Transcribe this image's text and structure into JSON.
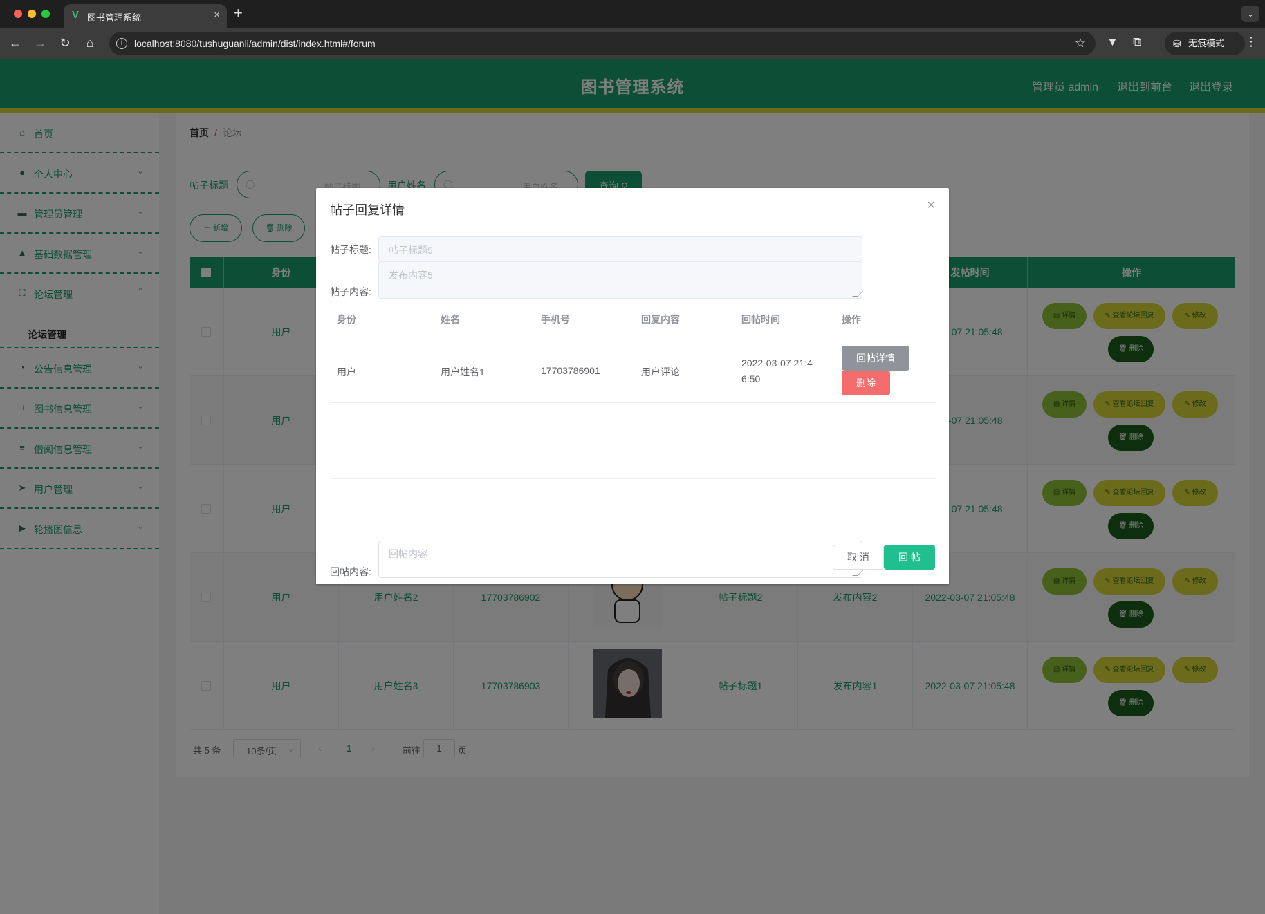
{
  "browser": {
    "tab_title": "图书管理系统",
    "url": "localhost:8080/tushuguanli/admin/dist/index.html#/forum",
    "incognito_label": "无痕模式"
  },
  "header": {
    "title": "图书管理系统",
    "user_label": "管理员 admin",
    "front_link": "退出到前台",
    "logout_link": "退出登录",
    "colors": {
      "primary": "#1a9e6c",
      "stripe": "#d9d739"
    }
  },
  "sidebar": {
    "items": [
      {
        "label": "首页",
        "icon": "home-icon"
      },
      {
        "label": "个人中心",
        "icon": "user-icon"
      },
      {
        "label": "管理员管理",
        "icon": "admin-icon"
      },
      {
        "label": "基础数据管理",
        "icon": "person-data-icon"
      },
      {
        "label": "论坛管理",
        "icon": "fullscreen-icon",
        "sub": "论坛管理"
      },
      {
        "label": "公告信息管理",
        "icon": "dashboard-icon"
      },
      {
        "label": "图书信息管理",
        "icon": "crop-icon"
      },
      {
        "label": "借阅信息管理",
        "icon": "list-icon"
      },
      {
        "label": "用户管理",
        "icon": "send-icon"
      },
      {
        "label": "轮播图信息",
        "icon": "video-icon"
      }
    ]
  },
  "breadcrumb": {
    "home": "首页",
    "current": "论坛"
  },
  "search": {
    "title_label": "帖子标题",
    "title_placeholder": "帖子标题",
    "name_label": "用户姓名",
    "name_placeholder": "用户姓名",
    "query_button": "查询"
  },
  "actions": {
    "add": "新增",
    "delete": "删除"
  },
  "table": {
    "headers": {
      "role": "身份",
      "post_time": "发帖时间",
      "ops": "操作"
    },
    "rows": [
      {
        "role": "用户",
        "name": "",
        "phone": "",
        "title": "",
        "content": "",
        "time": "03-07 21:05:48",
        "has_image": false
      },
      {
        "role": "用户",
        "name": "",
        "phone": "",
        "title": "",
        "content": "",
        "time": "03-07 21:05:48",
        "has_image": false
      },
      {
        "role": "用户",
        "name": "",
        "phone": "",
        "title": "",
        "content": "",
        "time": "03-07 21:05:48",
        "has_image": false
      },
      {
        "role": "用户",
        "name": "用户姓名2",
        "phone": "17703786902",
        "title": "帖子标题2",
        "content": "发布内容2",
        "time": "2022-03-07 21:05:48",
        "has_image": true
      },
      {
        "role": "用户",
        "name": "用户姓名3",
        "phone": "17703786903",
        "title": "帖子标题1",
        "content": "发布内容1",
        "time": "2022-03-07 21:05:48",
        "has_image": true
      }
    ],
    "row_buttons": {
      "detail": "详情",
      "replies": "查看论坛回复",
      "edit": "修改",
      "delete": "删除"
    }
  },
  "pagination": {
    "total": "共 5 条",
    "page_size": "10条/页",
    "current_page": "1",
    "goto_label": "前往",
    "goto_value": "1",
    "page_suffix": "页"
  },
  "dialog": {
    "title": "帖子回复详情",
    "post_title_label": "帖子标题:",
    "post_title_value": "帖子标题5",
    "post_content_label": "帖子内容:",
    "post_content_value": "发布内容5",
    "reply_headers": [
      "身份",
      "姓名",
      "手机号",
      "回复内容",
      "回帖时间",
      "操作"
    ],
    "replies": [
      {
        "role": "用户",
        "name": "用户姓名1",
        "phone": "17703786901",
        "content": "用户评论",
        "time_line1": "2022-03-07 21:4",
        "time_line2": "6:50"
      }
    ],
    "detail_button": "回帖详情",
    "delete_button": "删除",
    "reply_label": "回帖内容:",
    "reply_placeholder": "回帖内容",
    "cancel_button": "取 消",
    "submit_button": "回 帖"
  }
}
